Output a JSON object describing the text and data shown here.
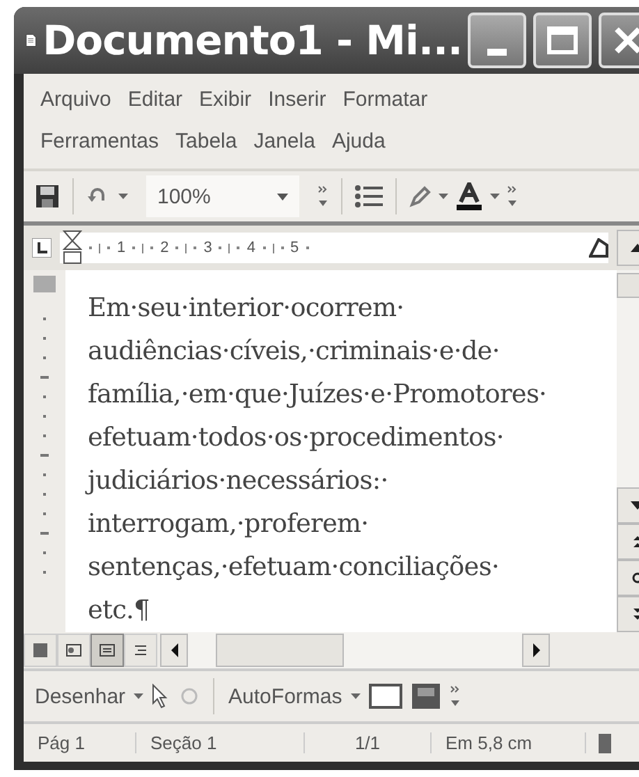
{
  "window": {
    "title": "Documento1 - Mi..."
  },
  "menu_bar": {
    "items": [
      "Arquivo",
      "Editar",
      "Exibir",
      "Inserir",
      "Formatar",
      "Ferramentas",
      "Tabela",
      "Janela",
      "Ajuda"
    ]
  },
  "toolbar": {
    "zoom": "100%"
  },
  "ruler": {
    "numbers": [
      "1",
      "2",
      "3",
      "4",
      "5"
    ]
  },
  "document": {
    "lines": [
      "Em·seu·interior·ocorrem·",
      "audiências·cíveis,·criminais·e·de·",
      "família,·em·que·Juízes·e·Promotores·",
      "efetuam·todos·os·procedimentos·",
      "judiciários·necessários:·",
      "interrogam,·proferem·",
      "sentenças,·efetuam·conciliações·",
      "etc.¶"
    ]
  },
  "drawing_toolbar": {
    "draw_label": "Desenhar",
    "autoshapes_label": "AutoFormas"
  },
  "status_bar": [
    "Pág 1",
    "Seção 1",
    "1/1",
    "Em 5,8 cm"
  ]
}
